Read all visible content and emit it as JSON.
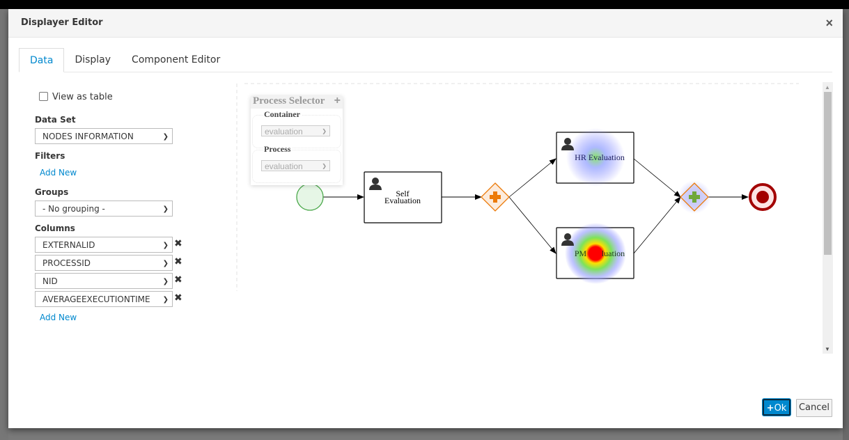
{
  "modal": {
    "title": "Displayer Editor",
    "close_icon": "close-icon"
  },
  "tabs": [
    {
      "label": "Data",
      "active": true
    },
    {
      "label": "Display",
      "active": false
    },
    {
      "label": "Component Editor",
      "active": false
    }
  ],
  "data_panel": {
    "view_as_table": {
      "label": "View as table",
      "checked": false
    },
    "data_set": {
      "label": "Data Set",
      "value": "NODES INFORMATION"
    },
    "filters": {
      "label": "Filters",
      "add_new": "Add New"
    },
    "groups": {
      "label": "Groups",
      "value": "- No grouping -"
    },
    "columns": {
      "label": "Columns",
      "items": [
        "EXTERNALID",
        "PROCESSID",
        "NID",
        "AVERAGEEXECUTIONTIME"
      ],
      "add_new": "Add New",
      "remove_icon": "remove-icon"
    }
  },
  "process_selector": {
    "title": "Process Selector",
    "expand_icon": "plus-icon",
    "container": {
      "label": "Container",
      "value": "evaluation"
    },
    "process": {
      "label": "Process",
      "value": "evaluation"
    }
  },
  "diagram": {
    "nodes": [
      {
        "id": "start",
        "type": "start-event"
      },
      {
        "id": "self",
        "type": "user-task",
        "label_lines": [
          "Self",
          "Evaluation"
        ]
      },
      {
        "id": "fork",
        "type": "parallel-gateway"
      },
      {
        "id": "hr",
        "type": "user-task",
        "label": "HR Evaluation",
        "heat": "low"
      },
      {
        "id": "pm",
        "type": "user-task",
        "label": "PM Evaluation",
        "heat": "high"
      },
      {
        "id": "join",
        "type": "parallel-gateway",
        "heat": "low"
      },
      {
        "id": "end",
        "type": "end-event"
      }
    ],
    "colors": {
      "start": "#4aa84a",
      "gateway": "#ec7a08",
      "end": "#a30000",
      "heat_low": "#8a8aff",
      "heat_mid": "#7de35a",
      "heat_high": "#ff0000"
    }
  },
  "footer": {
    "ok_label": "Ok",
    "ok_icon": "plus-icon",
    "cancel_label": "Cancel"
  }
}
